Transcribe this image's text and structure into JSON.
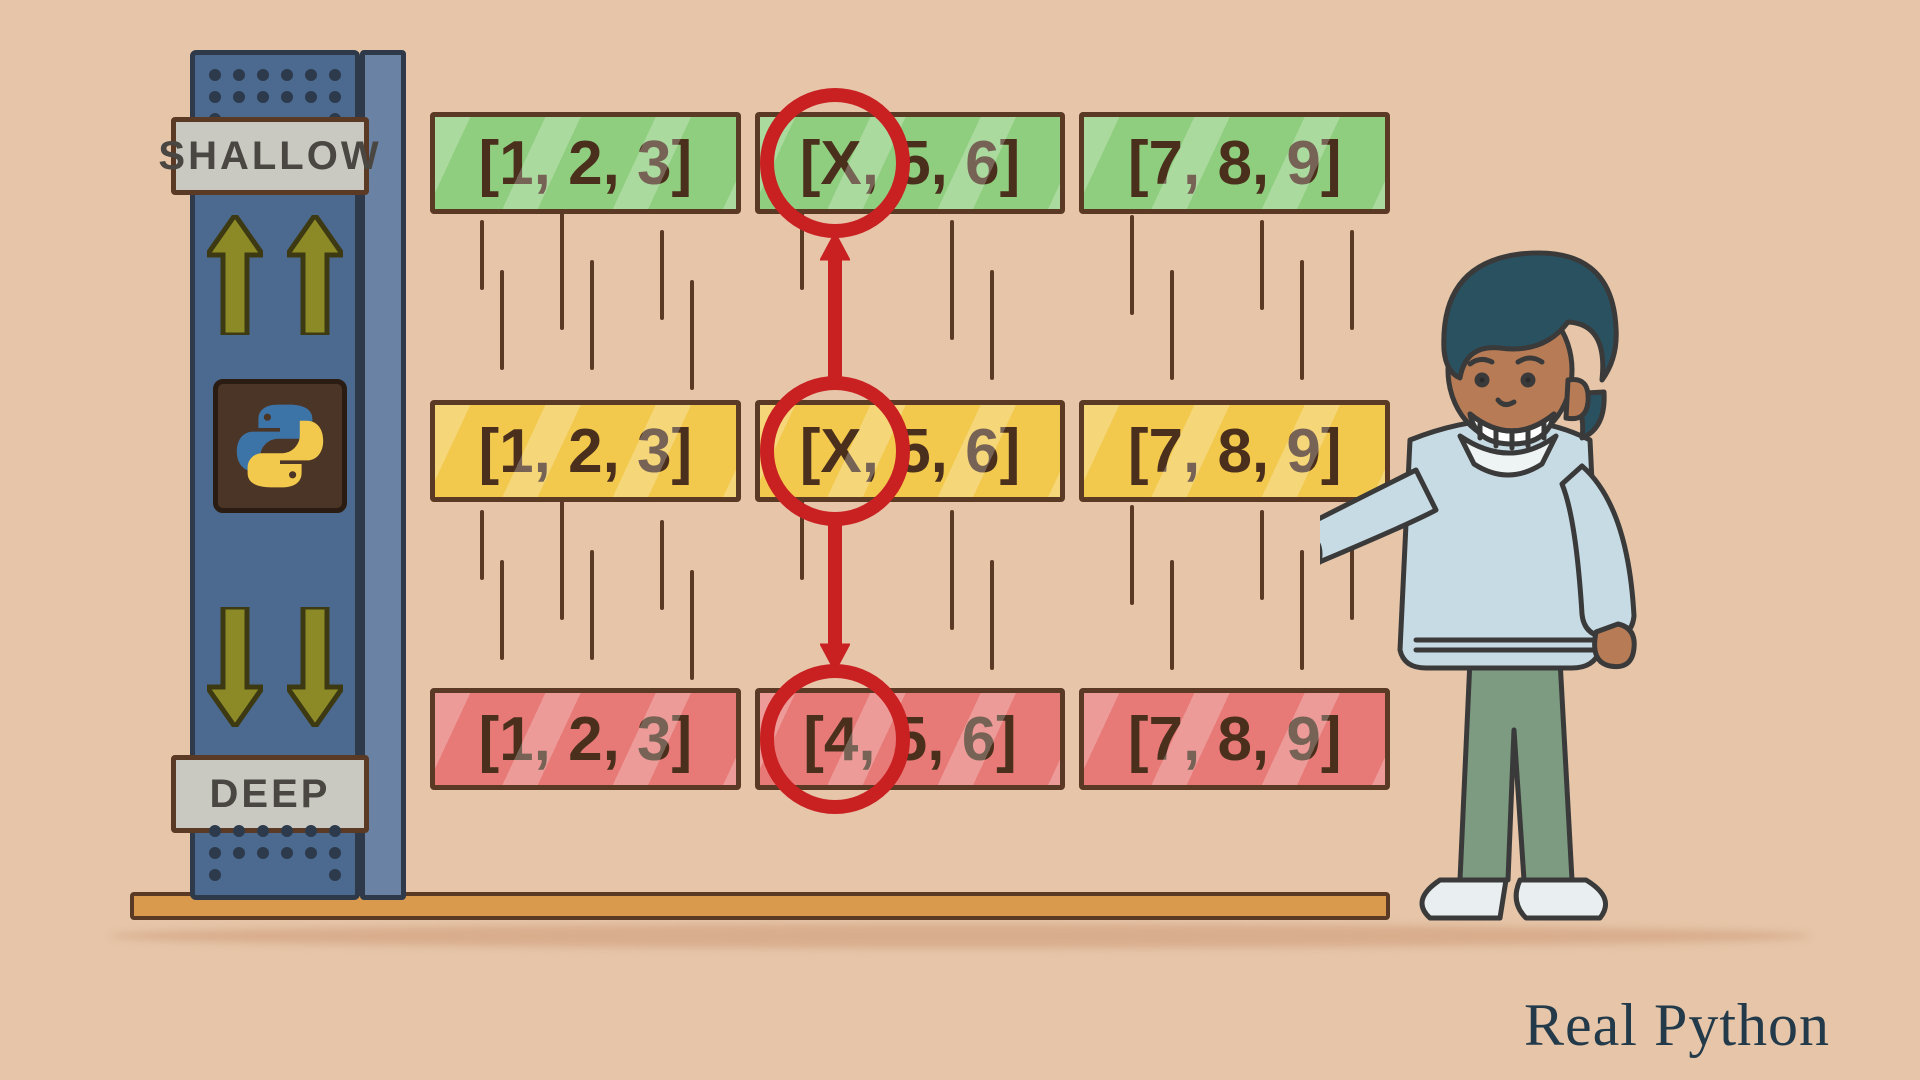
{
  "labels": {
    "shallow": "SHALLOW",
    "deep": "DEEP"
  },
  "rows": {
    "shallow": [
      "[1, 2, 3]",
      "[X,  5, 6]",
      "[7, 8, 9]"
    ],
    "original": [
      "[1, 2, 3]",
      "[X,  5, 6]",
      "[7, 8, 9]"
    ],
    "deep": [
      "[1, 2, 3]",
      "[4,  5, 6]",
      "[7, 8, 9]"
    ]
  },
  "highlight": {
    "column": 1,
    "shallow_shares_mutation": true,
    "deep_shares_mutation": false
  },
  "brand": "Real Python",
  "icons": {
    "language": "python-logo"
  },
  "colors": {
    "shallow_row": "#8fce7f",
    "original_row": "#f2c94c",
    "deep_row": "#e77a77",
    "accent": "#c92022"
  }
}
